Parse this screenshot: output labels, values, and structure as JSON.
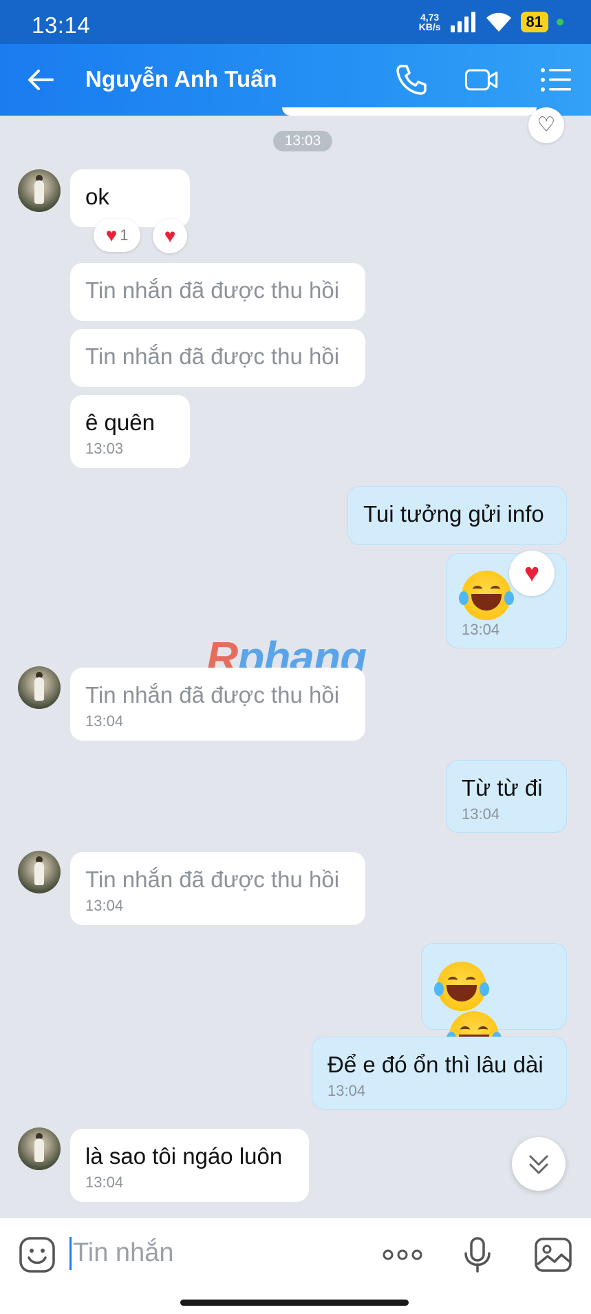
{
  "status": {
    "time": "13:14",
    "net_speed_value": "4,73",
    "net_speed_unit": "KB/s",
    "battery": "81"
  },
  "header": {
    "contact_name": "Nguyễn Anh Tuấn"
  },
  "chat": {
    "time_divider": "13:03",
    "messages": [
      {
        "side": "in",
        "text": "ok",
        "reaction_count": "1"
      },
      {
        "side": "in",
        "text": "Tin nhắn đã được thu hồi"
      },
      {
        "side": "in",
        "text": "Tin nhắn đã được thu hồi"
      },
      {
        "side": "in",
        "text": "ê quên",
        "time": "13:03"
      },
      {
        "side": "out",
        "text": "Tui tưởng gửi info"
      },
      {
        "side": "out",
        "emoji": "laughing-tears",
        "time": "13:04"
      },
      {
        "side": "in",
        "text": "Tin nhắn đã được thu hồi",
        "time": "13:04"
      },
      {
        "side": "out",
        "text": "Từ từ đi",
        "time": "13:04"
      },
      {
        "side": "in",
        "text": "Tin nhắn đã được thu hồi",
        "time": "13:04"
      },
      {
        "side": "out",
        "emoji": "laughing-tears x2"
      },
      {
        "side": "out",
        "text": "Để e đó ổn thì lâu dài",
        "time": "13:04"
      },
      {
        "side": "in",
        "text": "là sao tôi ngáo luôn",
        "time": "13:04"
      }
    ],
    "watermark": {
      "first": "R",
      "rest": "phang"
    }
  },
  "input": {
    "placeholder": "Tin nhắn"
  },
  "colors": {
    "header": "#1a7cf0",
    "outgoing_bubble": "#d3ecfb",
    "background": "#e2e6ec",
    "heart": "#e8223a"
  },
  "icons": [
    "back-arrow-icon",
    "phone-icon",
    "video-call-icon",
    "menu-list-icon",
    "heart-icon",
    "emoji-icon",
    "more-icon",
    "mic-icon",
    "image-icon",
    "chevron-double-down-icon"
  ]
}
